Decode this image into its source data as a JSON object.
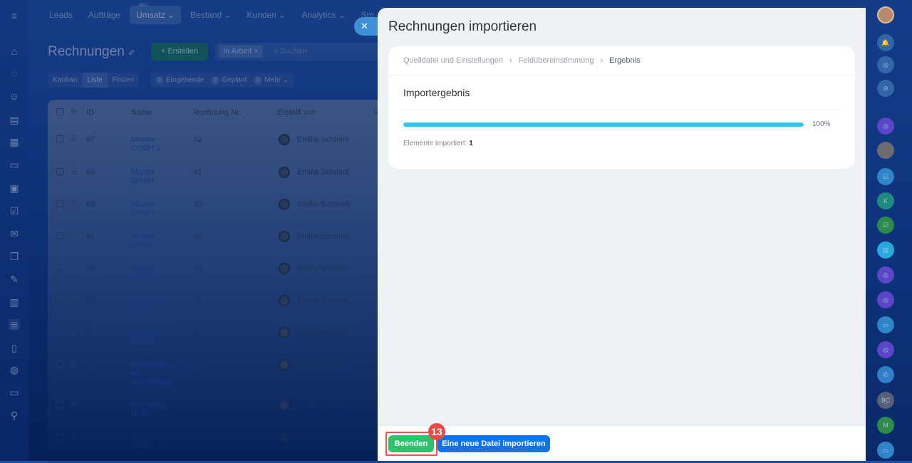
{
  "topnav": {
    "items": [
      "Leads",
      "Aufträge",
      "Umsatz",
      "Bestand",
      "Kunden",
      "Analytics",
      "Sm"
    ],
    "new_badge": "NEU"
  },
  "page": {
    "title": "Rechnungen",
    "create_label": "Erstellen",
    "filter_chip": "In Arbeit",
    "search_placeholder": "+ Suchen"
  },
  "views": [
    "Kanban",
    "Liste",
    "Fristen"
  ],
  "counters": [
    {
      "count": "0",
      "label": "Eingehende"
    },
    {
      "count": "0",
      "label": "Geplant"
    },
    {
      "count": "0",
      "label": "Mehr"
    }
  ],
  "table": {
    "headers": [
      "ID",
      "Name",
      "Rechnung Nr.",
      "Erstellt von",
      "V"
    ],
    "rows": [
      {
        "id": "67",
        "name": "Muster GmbH 1",
        "nr": "32",
        "by": "Emilia Schmidt"
      },
      {
        "id": "65",
        "name": "Muster GmbH",
        "nr": "31",
        "by": "Emilia Schmidt"
      },
      {
        "id": "63",
        "name": "Muster GmbH",
        "nr": "30",
        "by": "Emilia Schmidt"
      },
      {
        "id": "61",
        "name": "Muster GmbH",
        "nr": "29",
        "by": "Emilia Schmidt"
      },
      {
        "id": "59",
        "name": "Muster GmbH",
        "nr": "28",
        "by": "Emilia Schmidt"
      },
      {
        "id": "57",
        "name": "Rechnung Nr.57",
        "nr": "27",
        "by": "Emilia Schmidt"
      },
      {
        "id": "55",
        "name": "Muster GmbH",
        "nr": "26",
        "by": "Emilia Schmidt"
      },
      {
        "id": "53",
        "name": "Beschaffung der Ausrüstung",
        "nr": "25",
        "by": "Emilia Schmidt"
      },
      {
        "id": "47",
        "name": "Rechnung Nr.47",
        "nr": "22",
        "by": "Emilia Schmidt"
      },
      {
        "id": "43",
        "name": "Rechnung Nr.43",
        "nr": "234",
        "by": "Emilia Schmidt"
      }
    ]
  },
  "panel": {
    "title": "Rechnungen importieren",
    "breadcrumb": [
      "Quelldatei und Einstellungen",
      "Feldübereinstimmung",
      "Ergebnis"
    ],
    "result_title": "Importergebnis",
    "progress_percent": 100,
    "progress_label": "100%",
    "imported_label": "Elemente importiert:",
    "imported_count": "1",
    "finish_label": "Beenden",
    "new_file_label": "Eine neue Datei importieren",
    "step_badge": "13"
  },
  "right_column": {
    "initials": [
      "K",
      "BC",
      "M"
    ]
  }
}
